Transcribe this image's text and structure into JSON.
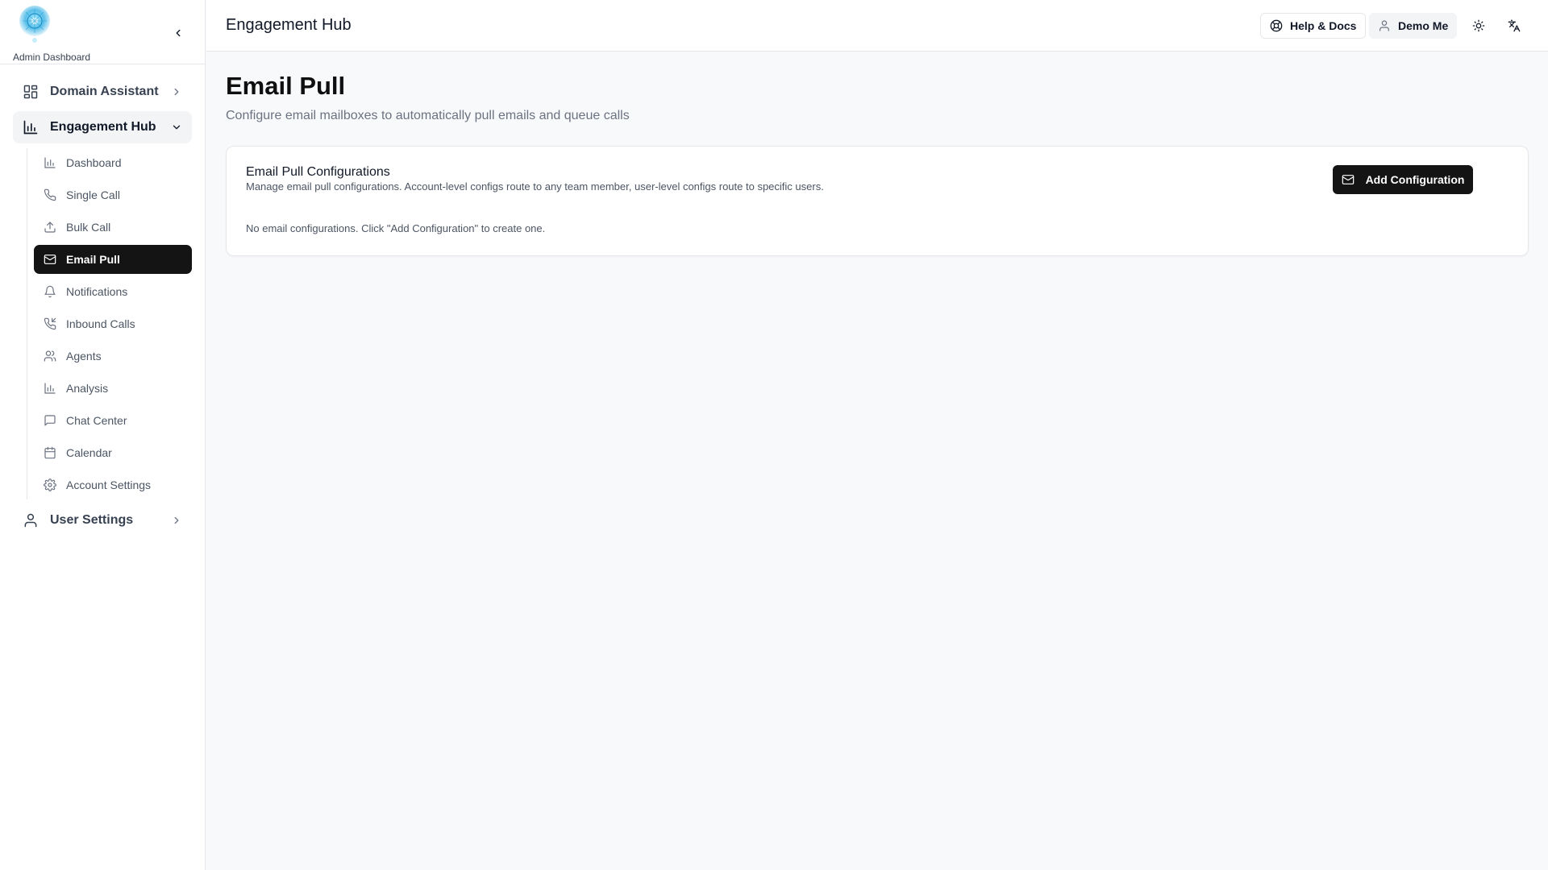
{
  "sidebar": {
    "brand_label": "Admin Dashboard",
    "collapse_icon": "chevron-left-icon",
    "nav": [
      {
        "label": "Domain Assistant",
        "icon": "layout-grid-icon",
        "expanded": false
      },
      {
        "label": "Engagement Hub",
        "icon": "bar-chart-icon",
        "expanded": true
      },
      {
        "label": "User Settings",
        "icon": "user-icon",
        "expanded": false
      }
    ],
    "sub_items": [
      {
        "label": "Dashboard",
        "icon": "bar-chart-icon"
      },
      {
        "label": "Single Call",
        "icon": "phone-icon"
      },
      {
        "label": "Bulk Call",
        "icon": "upload-icon"
      },
      {
        "label": "Email Pull",
        "icon": "mail-icon",
        "active": true
      },
      {
        "label": "Notifications",
        "icon": "bell-icon"
      },
      {
        "label": "Inbound Calls",
        "icon": "phone-incoming-icon"
      },
      {
        "label": "Agents",
        "icon": "users-icon"
      },
      {
        "label": "Analysis",
        "icon": "bar-chart-icon"
      },
      {
        "label": "Chat Center",
        "icon": "message-square-icon"
      },
      {
        "label": "Calendar",
        "icon": "calendar-icon"
      },
      {
        "label": "Account Settings",
        "icon": "gear-icon"
      }
    ]
  },
  "header": {
    "title": "Engagement Hub",
    "help_label": "Help & Docs",
    "user_label": "Demo Me",
    "theme_icon": "sun-icon",
    "language_icon": "languages-icon"
  },
  "main": {
    "title": "Email Pull",
    "subtitle": "Configure email mailboxes to automatically pull emails and queue calls",
    "card": {
      "title": "Email Pull Configurations",
      "description": "Manage email pull configurations. Account-level configs route to any team member, user-level configs route to specific users.",
      "add_button_label": "Add Configuration",
      "empty_message": "No email configurations. Click \"Add Configuration\" to create one."
    }
  },
  "colors": {
    "accent": "#141414",
    "page_background": "#f8f9fb",
    "border": "#e5e7eb"
  }
}
